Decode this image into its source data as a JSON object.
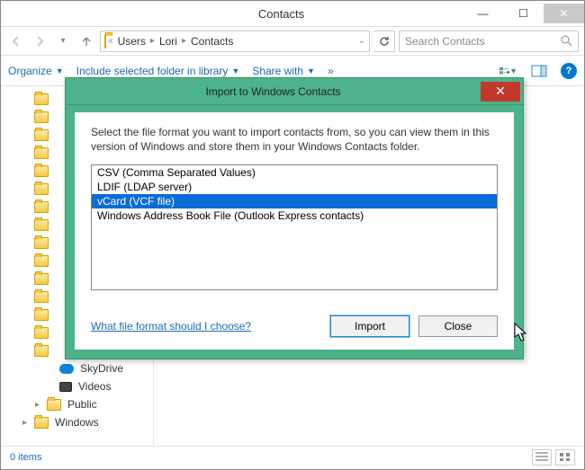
{
  "window": {
    "title": "Contacts"
  },
  "nav": {
    "crumbs": [
      "Users",
      "Lori",
      "Contacts"
    ],
    "search_placeholder": "Search Contacts"
  },
  "toolbar": {
    "organize": "Organize",
    "include": "Include selected folder in library",
    "share": "Share with",
    "more": "»"
  },
  "tree": {
    "items": [
      {
        "level": 1,
        "type": "folder",
        "label": ""
      },
      {
        "level": 1,
        "type": "folder",
        "label": ""
      },
      {
        "level": 1,
        "type": "folder",
        "label": ""
      },
      {
        "level": 1,
        "type": "folder",
        "label": ""
      },
      {
        "level": 1,
        "type": "folder",
        "label": ""
      },
      {
        "level": 1,
        "type": "folder",
        "label": ""
      },
      {
        "level": 1,
        "type": "folder",
        "label": ""
      },
      {
        "level": 1,
        "type": "folder",
        "label": ""
      },
      {
        "level": 1,
        "type": "folder",
        "label": ""
      },
      {
        "level": 1,
        "type": "folder",
        "label": ""
      },
      {
        "level": 1,
        "type": "folder",
        "label": ""
      },
      {
        "level": 1,
        "type": "folder",
        "label": ""
      },
      {
        "level": 1,
        "type": "folder",
        "label": ""
      },
      {
        "level": 1,
        "type": "folder",
        "label": ""
      },
      {
        "level": 1,
        "type": "folder",
        "label": ""
      },
      {
        "level": 3,
        "type": "skydrive",
        "label": "SkyDrive"
      },
      {
        "level": 3,
        "type": "video",
        "label": "Videos"
      },
      {
        "level": 2,
        "type": "folder",
        "label": "Public",
        "caret": "▸"
      },
      {
        "level": 1,
        "type": "folder",
        "label": "Windows",
        "caret": "▸"
      }
    ]
  },
  "status": {
    "items": "0 items"
  },
  "dialog": {
    "title": "Import to Windows Contacts",
    "desc": "Select the file format you want to import contacts from, so you can view them in this version of Windows and store them in your Windows Contacts folder.",
    "options": [
      "CSV (Comma Separated Values)",
      "LDIF (LDAP server)",
      "vCard (VCF file)",
      "Windows Address Book File (Outlook Express contacts)"
    ],
    "selected_index": 2,
    "help_link": "What file format should I choose?",
    "import_btn": "Import",
    "close_btn": "Close"
  }
}
